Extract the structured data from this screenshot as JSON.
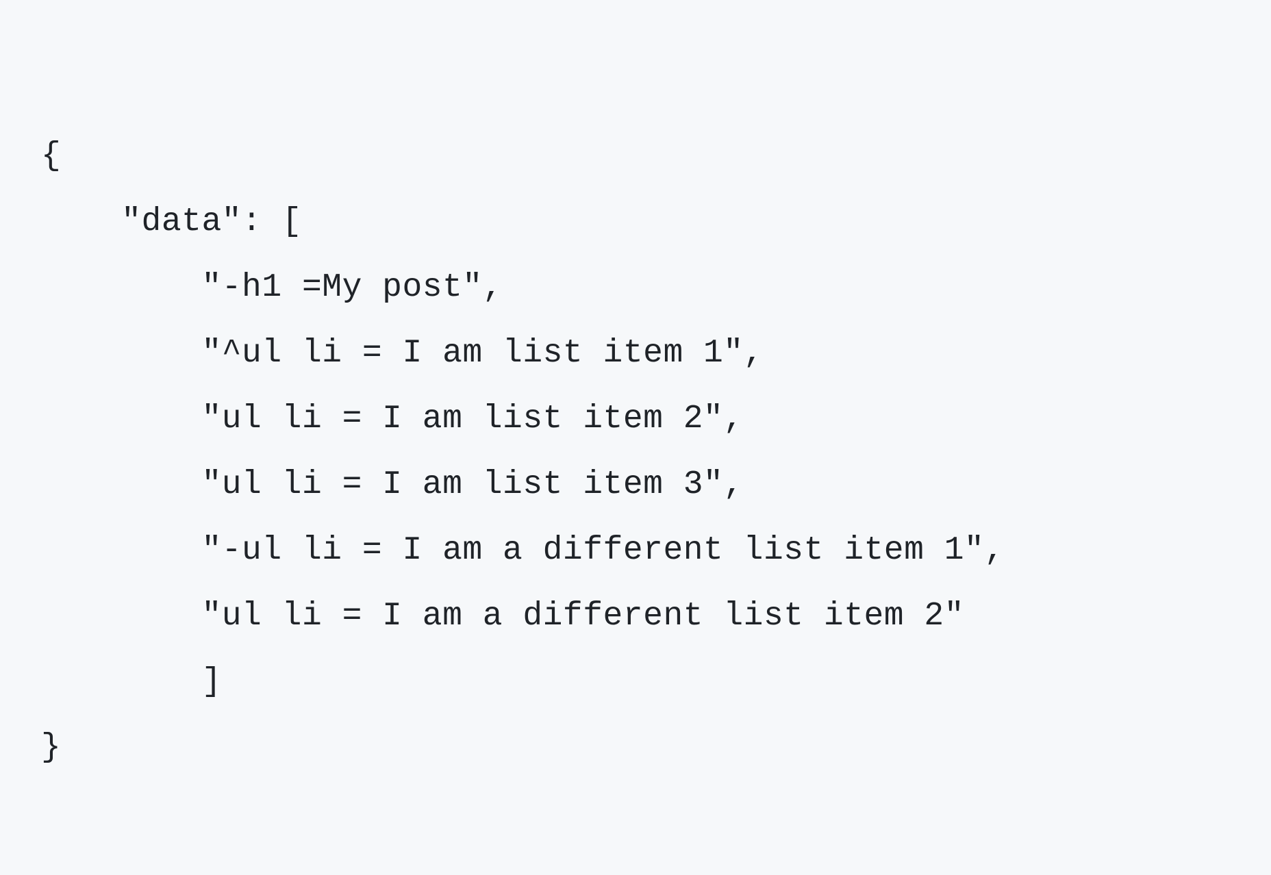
{
  "code": {
    "lines": [
      "{",
      "    \"data\": [",
      "        \"-h1 =My post\",",
      "        \"^ul li = I am list item 1\",",
      "        \"ul li = I am list item 2\",",
      "        \"ul li = I am list item 3\",",
      "        \"-ul li = I am a different list item 1\",",
      "        \"ul li = I am a different list item 2\"",
      "        ]",
      "}"
    ]
  }
}
